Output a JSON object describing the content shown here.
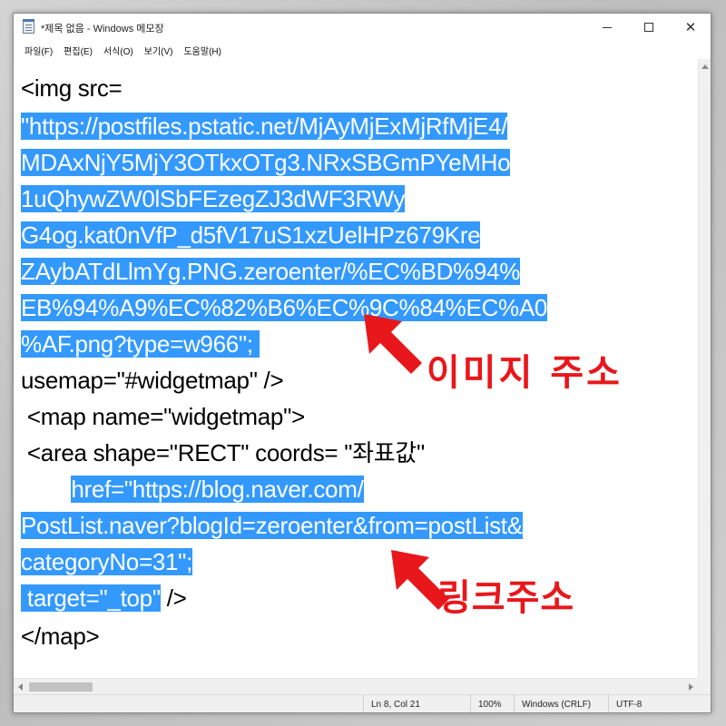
{
  "window": {
    "title": "*제목 없음 - Windows 메모장",
    "minimize_icon": "minimize-icon",
    "maximize_icon": "maximize-icon",
    "close_icon": "close-icon",
    "close_glyph": "✕"
  },
  "menubar": {
    "items": [
      {
        "label": "파일(F)"
      },
      {
        "label": "편집(E)"
      },
      {
        "label": "서식(O)"
      },
      {
        "label": "보기(V)"
      },
      {
        "label": "도움말(H)"
      }
    ]
  },
  "editor": {
    "lines": [
      {
        "plain": "<img src=",
        "selected": "",
        "after": ""
      },
      {
        "plain": "",
        "selected": "\"https://postfiles.pstatic.net/MjAyMjExMjRfMjE4/",
        "after": ""
      },
      {
        "plain": "",
        "selected": "MDAxNjY5MjY3OTkxOTg3.NRxSBGmPYeMHo",
        "after": ""
      },
      {
        "plain": "",
        "selected": "1uQhywZW0lSbFEzegZJ3dWF3RWy",
        "after": ""
      },
      {
        "plain": "",
        "selected": "G4og.kat0nVfP_d5fV17uS1xzUelHPz679Kre",
        "after": ""
      },
      {
        "plain": "",
        "selected": "ZAybATdLlmYg.PNG.zeroenter/%EC%BD%94%",
        "after": ""
      },
      {
        "plain": "",
        "selected": "EB%94%A9%EC%82%B6%EC%9C%84%EC%A0",
        "after": ""
      },
      {
        "plain": "",
        "selected": "%AF.png?type=w966\"; ",
        "after": ""
      },
      {
        "plain": "usemap=\"#widgetmap\" />",
        "selected": "",
        "after": ""
      },
      {
        "plain": " <map name=\"widgetmap\">",
        "selected": "",
        "after": ""
      },
      {
        "plain": " <area shape=\"RECT\" coords= \"좌표값\"",
        "selected": "",
        "after": ""
      },
      {
        "plain": "        ",
        "selected": "href=\"https://blog.naver.com/",
        "after": ""
      },
      {
        "plain": "",
        "selected": "PostList.naver?blogId=zeroenter&from=postList&",
        "after": ""
      },
      {
        "plain": "",
        "selected": "categoryNo=31\";",
        "after": ""
      },
      {
        "plain": "",
        "selected": " target=\"_top\"",
        "after": " />"
      },
      {
        "plain": "</map>",
        "selected": "",
        "after": ""
      }
    ]
  },
  "statusbar": {
    "position": "Ln 8, Col 21",
    "zoom": "100%",
    "line_ending": "Windows (CRLF)",
    "encoding": "UTF-8"
  },
  "annotations": {
    "image_address": "이미지 주소",
    "link_address": "링크주소",
    "color": "#e8171b"
  },
  "colors": {
    "selection": "#3399ff",
    "annotation": "#e8171b"
  }
}
